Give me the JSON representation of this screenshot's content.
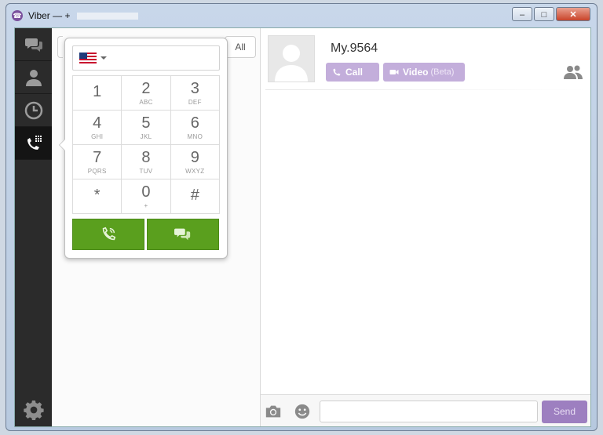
{
  "window": {
    "title": "Viber — +",
    "app_icon": "viber-logo-icon",
    "controls": {
      "minimize": "–",
      "maximize": "□",
      "close": "✕"
    }
  },
  "sidebar": {
    "items": [
      {
        "name": "chats",
        "icon": "chat-bubbles-icon"
      },
      {
        "name": "contacts",
        "icon": "person-icon"
      },
      {
        "name": "recents",
        "icon": "clock-icon"
      },
      {
        "name": "dialpad",
        "icon": "phone-keypad-icon",
        "active": true
      }
    ],
    "settings_icon": "gear-icon"
  },
  "contacts": {
    "filter_all": "All"
  },
  "dialpad": {
    "country_flag": "us-flag-icon",
    "keys": [
      {
        "num": "1",
        "letters": ""
      },
      {
        "num": "2",
        "letters": "ABC"
      },
      {
        "num": "3",
        "letters": "DEF"
      },
      {
        "num": "4",
        "letters": "GHI"
      },
      {
        "num": "5",
        "letters": "JKL"
      },
      {
        "num": "6",
        "letters": "MNO"
      },
      {
        "num": "7",
        "letters": "PQRS"
      },
      {
        "num": "8",
        "letters": "TUV"
      },
      {
        "num": "9",
        "letters": "WXYZ"
      },
      {
        "num": "*",
        "letters": ""
      },
      {
        "num": "0",
        "letters": "+"
      },
      {
        "num": "#",
        "letters": ""
      }
    ],
    "call_icon": "phone-icon",
    "message_icon": "chat-bubbles-icon",
    "accent": "#5a9f1e"
  },
  "chat": {
    "contact_name": "My.9564",
    "call_label": "Call",
    "video_label": "Video",
    "video_badge": "(Beta)",
    "group_icon": "group-people-icon",
    "accent": "#c3aedb",
    "composer": {
      "camera_icon": "camera-icon",
      "emoji_icon": "smiley-icon",
      "placeholder": "",
      "send_label": "Send"
    }
  }
}
